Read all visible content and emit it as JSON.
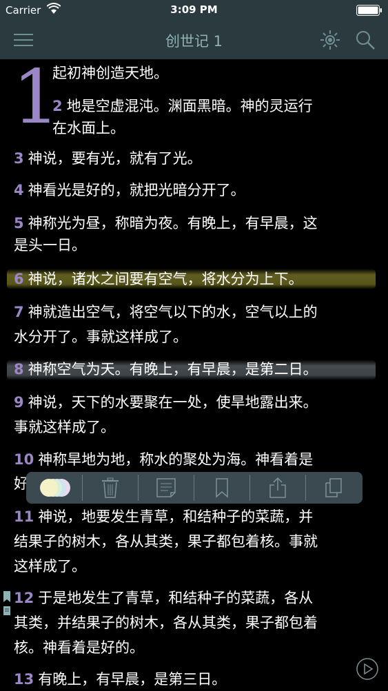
{
  "status_bar": {
    "carrier": "Carrier",
    "time": "3:09 PM"
  },
  "nav": {
    "title": "创世记 1"
  },
  "icons": {
    "menu": "hamburger-menu-icon",
    "brightness": "brightness-icon",
    "search": "search-icon",
    "color": "color-picker-icon",
    "delete": "trash-icon",
    "note": "note-icon",
    "bookmark": "bookmark-icon",
    "share": "share-icon",
    "copy": "copy-icon",
    "play": "play-icon"
  },
  "colors": {
    "bar": "#2a3a3f",
    "title": "#8fb2b4",
    "verse_number": "#9b86c6",
    "highlight_yellow": "#807c2c",
    "highlight_gray": "#5c6468"
  },
  "chapter": {
    "drop_cap": "1",
    "lines": [
      {
        "num": "",
        "text": "起初神创造天地。"
      },
      {
        "num": "2",
        "text": "地是空虚混沌。渊面黑暗。神的灵运行"
      },
      {
        "num": "",
        "text": "在水面上。"
      },
      {
        "num": "3",
        "text": "神说，要有光，就有了光。"
      },
      {
        "num": "4",
        "text": "神看光是好的，就把光暗分开了。"
      },
      {
        "num": "5",
        "text": "神称光为昼，称暗为夜。有晚上，有早晨，这"
      },
      {
        "num": "",
        "text": "是头一日。"
      },
      {
        "num": "6",
        "text": "神说，诸水之间要有空气，将水分为上下。"
      },
      {
        "num": "7",
        "text": "神就造出空气，将空气以下的水，空气以上的"
      },
      {
        "num": "",
        "text": "水分开了。事就这样成了。"
      },
      {
        "num": "8",
        "text": "神称空气为天。有晚上，有早晨，是第二日。"
      },
      {
        "num": "9",
        "text": "神说，天下的水要聚在一处，使旱地露出来。"
      },
      {
        "num": "",
        "text": "事就这样成了。"
      },
      {
        "num": "10",
        "text": "神称旱地为地，称水的聚处为海。神看着是"
      },
      {
        "num": "",
        "text": "好"
      },
      {
        "num": "11",
        "text": "神说，地要发生青草，和结种子的菜蔬，并"
      },
      {
        "num": "",
        "text": "结果子的树木，各从其类，果子都包着核。事就"
      },
      {
        "num": "",
        "text": "这样成了。"
      },
      {
        "num": "12",
        "text": "于是地发生了青草，和结种子的菜蔬，各从"
      },
      {
        "num": "",
        "text": "其类，并结果子的树木，各从其类，果子都包着"
      },
      {
        "num": "",
        "text": "核。神看着是好的。"
      },
      {
        "num": "13",
        "text": "有晚上，有早晨，是第三日。"
      }
    ]
  }
}
